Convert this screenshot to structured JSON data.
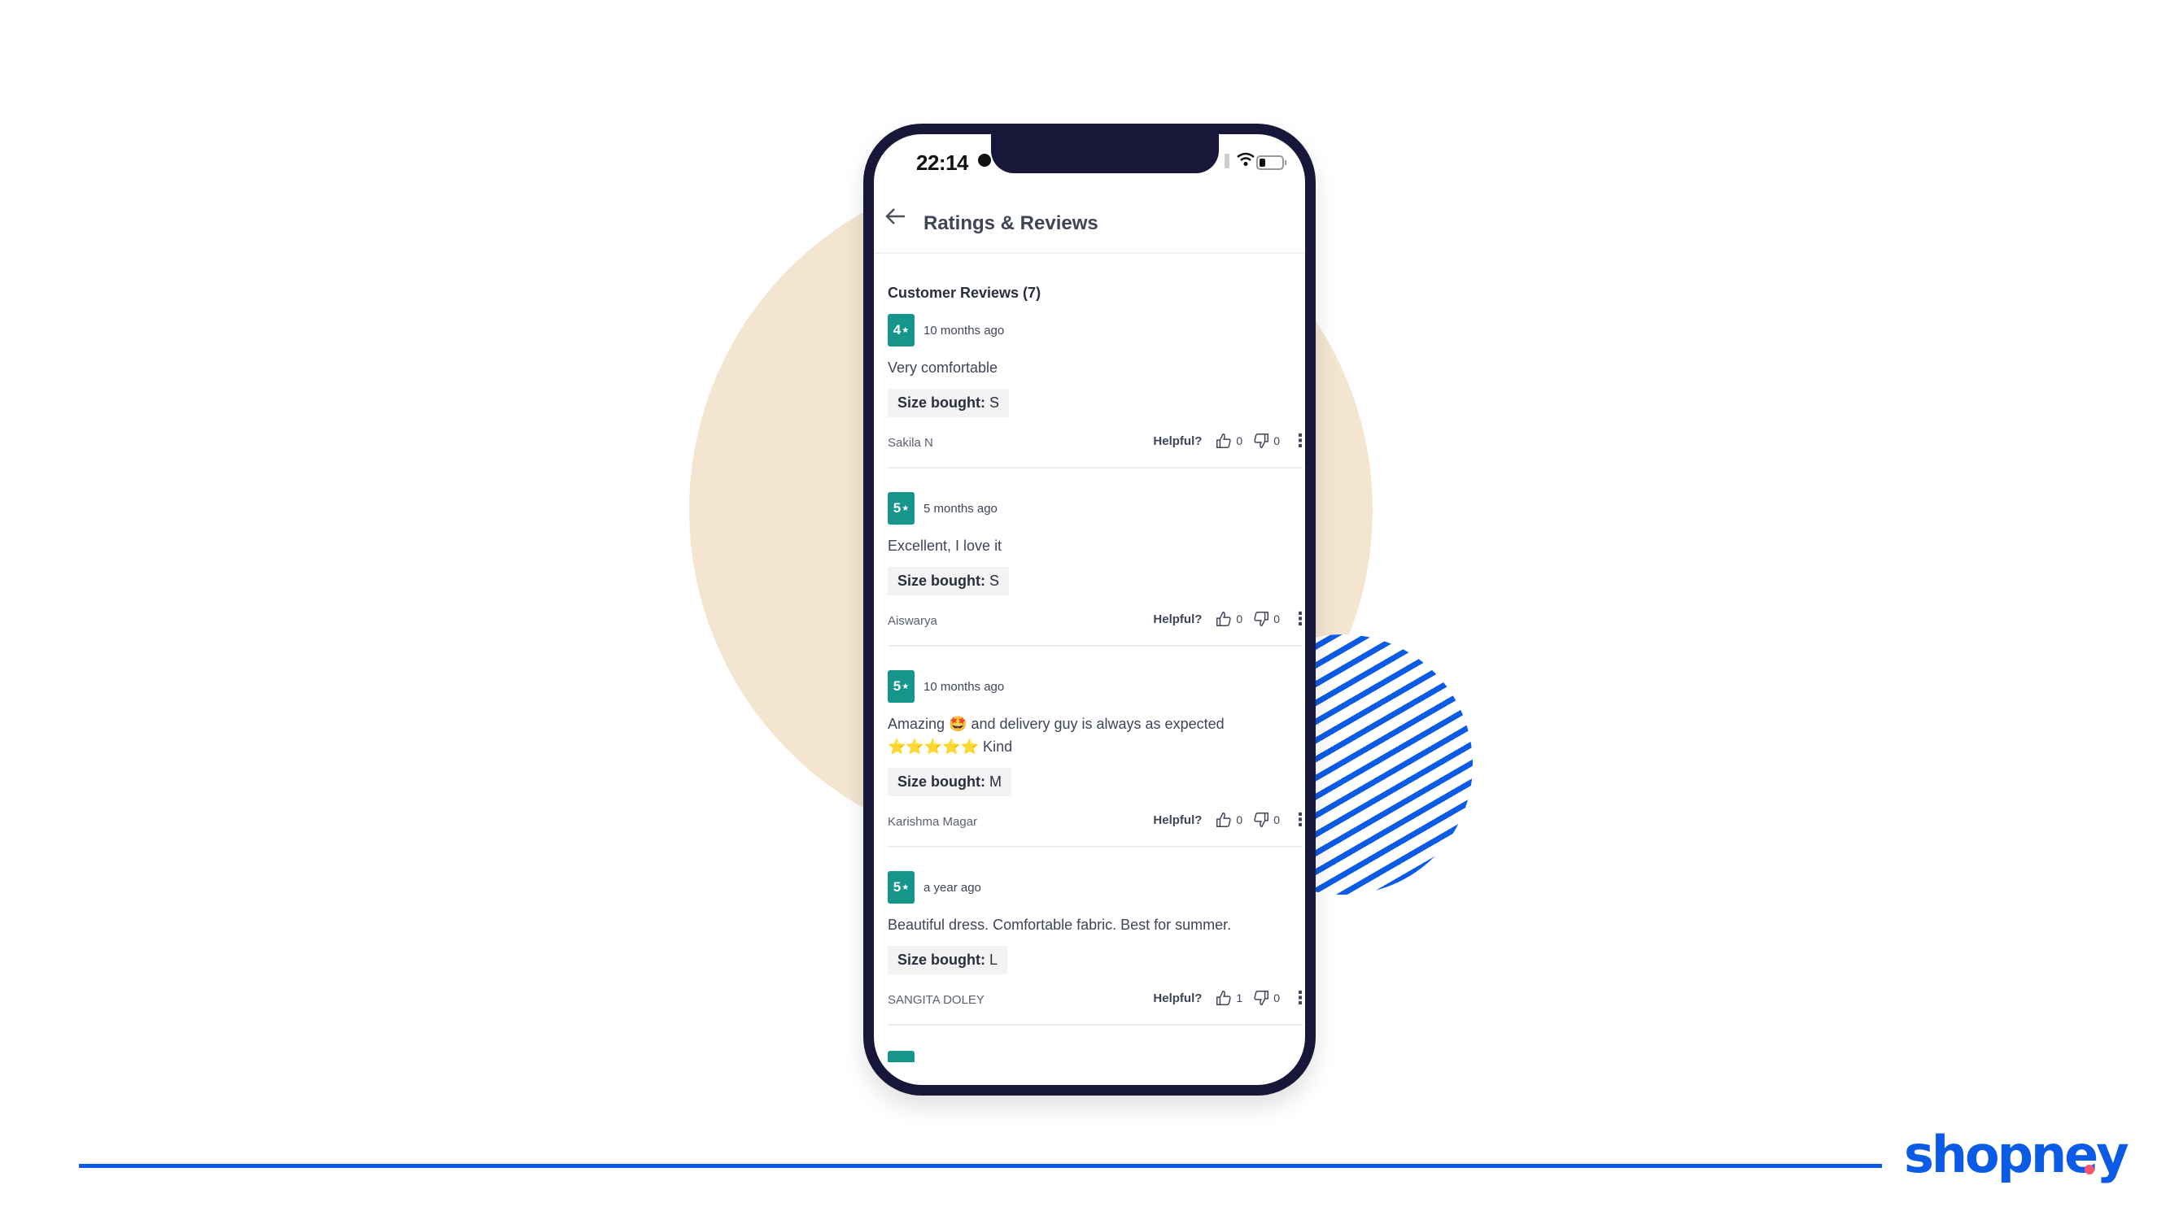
{
  "status_bar": {
    "time": "22:14"
  },
  "header": {
    "back_icon": "arrow-left-icon",
    "title": "Ratings & Reviews"
  },
  "section": {
    "title": "Customer Reviews (7)"
  },
  "labels": {
    "size_bought": "Size bought:",
    "helpful": "Helpful?",
    "star": "★",
    "more": "⋮"
  },
  "colors": {
    "badge": "#16968b",
    "brand": "#0b5be6",
    "accent_dot": "#f2566f",
    "frame": "#18173a",
    "beige": "#f3e5d0"
  },
  "reviews": [
    {
      "rating": "4",
      "date": "10 months ago",
      "text": "Very comfortable",
      "size": "S",
      "author": "Sakila N",
      "likes": "0",
      "dislikes": "0"
    },
    {
      "rating": "5",
      "date": "5 months ago",
      "text": "Excellent, I love it",
      "size": "S",
      "author": "Aiswarya",
      "likes": "0",
      "dislikes": "0"
    },
    {
      "rating": "5",
      "date": "10 months ago",
      "text": "Amazing 🤩 and delivery guy is always as expected ⭐⭐⭐⭐⭐ Kind",
      "size": "M",
      "author": "Karishma Magar",
      "likes": "0",
      "dislikes": "0"
    },
    {
      "rating": "5",
      "date": "a year ago",
      "text": "Beautiful dress. Comfortable fabric. Best for summer.",
      "size": "L",
      "author": "SANGITA DOLEY",
      "likes": "1",
      "dislikes": "0"
    }
  ],
  "brand": {
    "logo_text": "shopney"
  }
}
